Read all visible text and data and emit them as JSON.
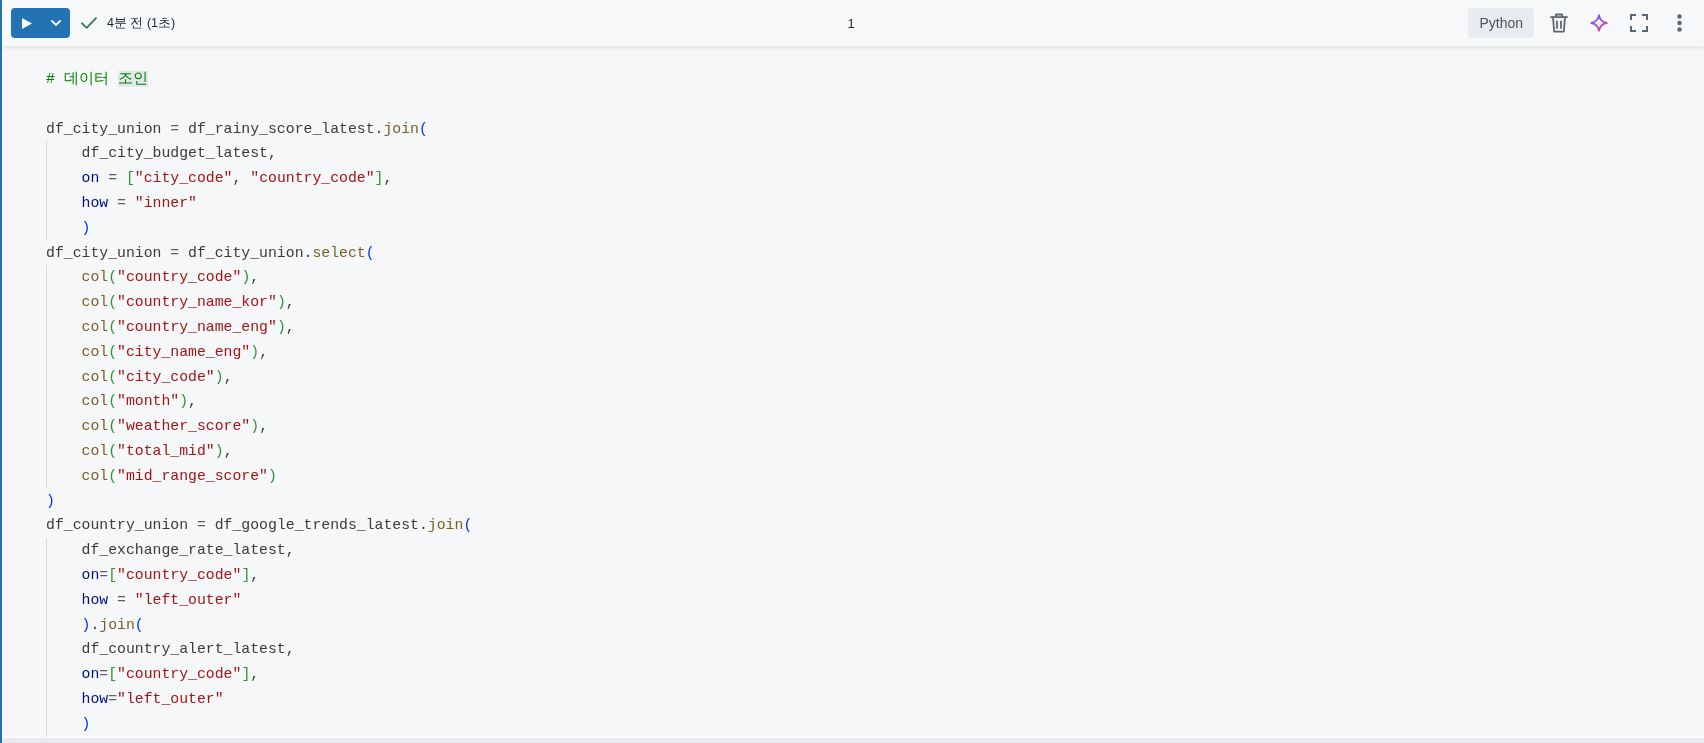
{
  "toolbar": {
    "run_succeeded": true,
    "status_text": "4분 전 (1초)",
    "cell_title": "1",
    "language": "Python"
  },
  "editor": {
    "comment": {
      "tokens": [
        {
          "kind": "comment",
          "text": "# 데이터 "
        },
        {
          "kind": "highlight",
          "text": "조인"
        }
      ]
    },
    "lines": [
      {
        "tokens": [
          {
            "kind": "name",
            "text": "df_city_union"
          },
          {
            "kind": "op",
            "text": " = "
          },
          {
            "kind": "name",
            "text": "df_rainy_score_latest"
          },
          {
            "kind": "punct",
            "text": "."
          },
          {
            "kind": "method",
            "text": "join"
          },
          {
            "kind": "bracket1",
            "text": "("
          }
        ],
        "children": [
          {
            "tokens": [
              {
                "kind": "name",
                "text": "df_city_budget_latest"
              },
              {
                "kind": "punct",
                "text": ","
              }
            ]
          },
          {
            "tokens": [
              {
                "kind": "param",
                "text": "on"
              },
              {
                "kind": "op",
                "text": " = "
              },
              {
                "kind": "bracket2",
                "text": "["
              },
              {
                "kind": "string",
                "text": "\"city_code\""
              },
              {
                "kind": "punct",
                "text": ", "
              },
              {
                "kind": "string",
                "text": "\"country_code\""
              },
              {
                "kind": "bracket2",
                "text": "]"
              },
              {
                "kind": "punct",
                "text": ","
              }
            ]
          },
          {
            "tokens": [
              {
                "kind": "param",
                "text": "how"
              },
              {
                "kind": "op",
                "text": " = "
              },
              {
                "kind": "string",
                "text": "\"inner\""
              }
            ]
          },
          {
            "tokens": [
              {
                "kind": "bracket1",
                "text": ")"
              }
            ]
          }
        ]
      },
      {
        "tokens": [
          {
            "kind": "name",
            "text": "df_city_union"
          },
          {
            "kind": "op",
            "text": " = "
          },
          {
            "kind": "name",
            "text": "df_city_union"
          },
          {
            "kind": "punct",
            "text": "."
          },
          {
            "kind": "method",
            "text": "select"
          },
          {
            "kind": "bracket1",
            "text": "("
          }
        ],
        "children": [
          {
            "tokens": [
              {
                "kind": "method",
                "text": "col"
              },
              {
                "kind": "bracket2",
                "text": "("
              },
              {
                "kind": "string",
                "text": "\"country_code\""
              },
              {
                "kind": "bracket2",
                "text": ")"
              },
              {
                "kind": "punct",
                "text": ","
              }
            ]
          },
          {
            "tokens": [
              {
                "kind": "method",
                "text": "col"
              },
              {
                "kind": "bracket2",
                "text": "("
              },
              {
                "kind": "string",
                "text": "\"country_name_kor\""
              },
              {
                "kind": "bracket2",
                "text": ")"
              },
              {
                "kind": "punct",
                "text": ","
              }
            ]
          },
          {
            "tokens": [
              {
                "kind": "method",
                "text": "col"
              },
              {
                "kind": "bracket2",
                "text": "("
              },
              {
                "kind": "string",
                "text": "\"country_name_eng\""
              },
              {
                "kind": "bracket2",
                "text": ")"
              },
              {
                "kind": "punct",
                "text": ","
              }
            ]
          },
          {
            "tokens": [
              {
                "kind": "method",
                "text": "col"
              },
              {
                "kind": "bracket2",
                "text": "("
              },
              {
                "kind": "string",
                "text": "\"city_name_eng\""
              },
              {
                "kind": "bracket2",
                "text": ")"
              },
              {
                "kind": "punct",
                "text": ","
              }
            ]
          },
          {
            "tokens": [
              {
                "kind": "method",
                "text": "col"
              },
              {
                "kind": "bracket2",
                "text": "("
              },
              {
                "kind": "string",
                "text": "\"city_code\""
              },
              {
                "kind": "bracket2",
                "text": ")"
              },
              {
                "kind": "punct",
                "text": ","
              }
            ]
          },
          {
            "tokens": [
              {
                "kind": "method",
                "text": "col"
              },
              {
                "kind": "bracket2",
                "text": "("
              },
              {
                "kind": "string",
                "text": "\"month\""
              },
              {
                "kind": "bracket2",
                "text": ")"
              },
              {
                "kind": "punct",
                "text": ","
              }
            ]
          },
          {
            "tokens": [
              {
                "kind": "method",
                "text": "col"
              },
              {
                "kind": "bracket2",
                "text": "("
              },
              {
                "kind": "string",
                "text": "\"weather_score\""
              },
              {
                "kind": "bracket2",
                "text": ")"
              },
              {
                "kind": "punct",
                "text": ","
              }
            ]
          },
          {
            "tokens": [
              {
                "kind": "method",
                "text": "col"
              },
              {
                "kind": "bracket2",
                "text": "("
              },
              {
                "kind": "string",
                "text": "\"total_mid\""
              },
              {
                "kind": "bracket2",
                "text": ")"
              },
              {
                "kind": "punct",
                "text": ","
              }
            ]
          },
          {
            "tokens": [
              {
                "kind": "method",
                "text": "col"
              },
              {
                "kind": "bracket2",
                "text": "("
              },
              {
                "kind": "string",
                "text": "\"mid_range_score\""
              },
              {
                "kind": "bracket2",
                "text": ")"
              }
            ]
          }
        ]
      },
      {
        "tokens": [
          {
            "kind": "bracket1",
            "text": ")"
          }
        ]
      },
      {
        "tokens": [
          {
            "kind": "name",
            "text": "df_country_union"
          },
          {
            "kind": "op",
            "text": " = "
          },
          {
            "kind": "name",
            "text": "df_google_trends_latest"
          },
          {
            "kind": "punct",
            "text": "."
          },
          {
            "kind": "method",
            "text": "join"
          },
          {
            "kind": "bracket1",
            "text": "("
          }
        ],
        "children": [
          {
            "tokens": [
              {
                "kind": "name",
                "text": "df_exchange_rate_latest"
              },
              {
                "kind": "punct",
                "text": ","
              }
            ]
          },
          {
            "tokens": [
              {
                "kind": "param",
                "text": "on"
              },
              {
                "kind": "op",
                "text": "="
              },
              {
                "kind": "bracket2",
                "text": "["
              },
              {
                "kind": "string",
                "text": "\"country_code\""
              },
              {
                "kind": "bracket2",
                "text": "]"
              },
              {
                "kind": "punct",
                "text": ","
              }
            ]
          },
          {
            "tokens": [
              {
                "kind": "param",
                "text": "how"
              },
              {
                "kind": "op",
                "text": " = "
              },
              {
                "kind": "string",
                "text": "\"left_outer\""
              }
            ]
          },
          {
            "tokens": [
              {
                "kind": "bracket1",
                "text": ")"
              },
              {
                "kind": "punct",
                "text": "."
              },
              {
                "kind": "method",
                "text": "join"
              },
              {
                "kind": "bracket1",
                "text": "("
              }
            ]
          },
          {
            "tokens": [
              {
                "kind": "name",
                "text": "df_country_alert_latest"
              },
              {
                "kind": "punct",
                "text": ","
              }
            ]
          },
          {
            "tokens": [
              {
                "kind": "param",
                "text": "on"
              },
              {
                "kind": "op",
                "text": "="
              },
              {
                "kind": "bracket2",
                "text": "["
              },
              {
                "kind": "string",
                "text": "\"country_code\""
              },
              {
                "kind": "bracket2",
                "text": "]"
              },
              {
                "kind": "punct",
                "text": ","
              }
            ]
          },
          {
            "tokens": [
              {
                "kind": "param",
                "text": "how"
              },
              {
                "kind": "op",
                "text": "="
              },
              {
                "kind": "string",
                "text": "\"left_outer\""
              }
            ]
          },
          {
            "tokens": [
              {
                "kind": "bracket1",
                "text": ")"
              }
            ]
          }
        ]
      }
    ]
  }
}
